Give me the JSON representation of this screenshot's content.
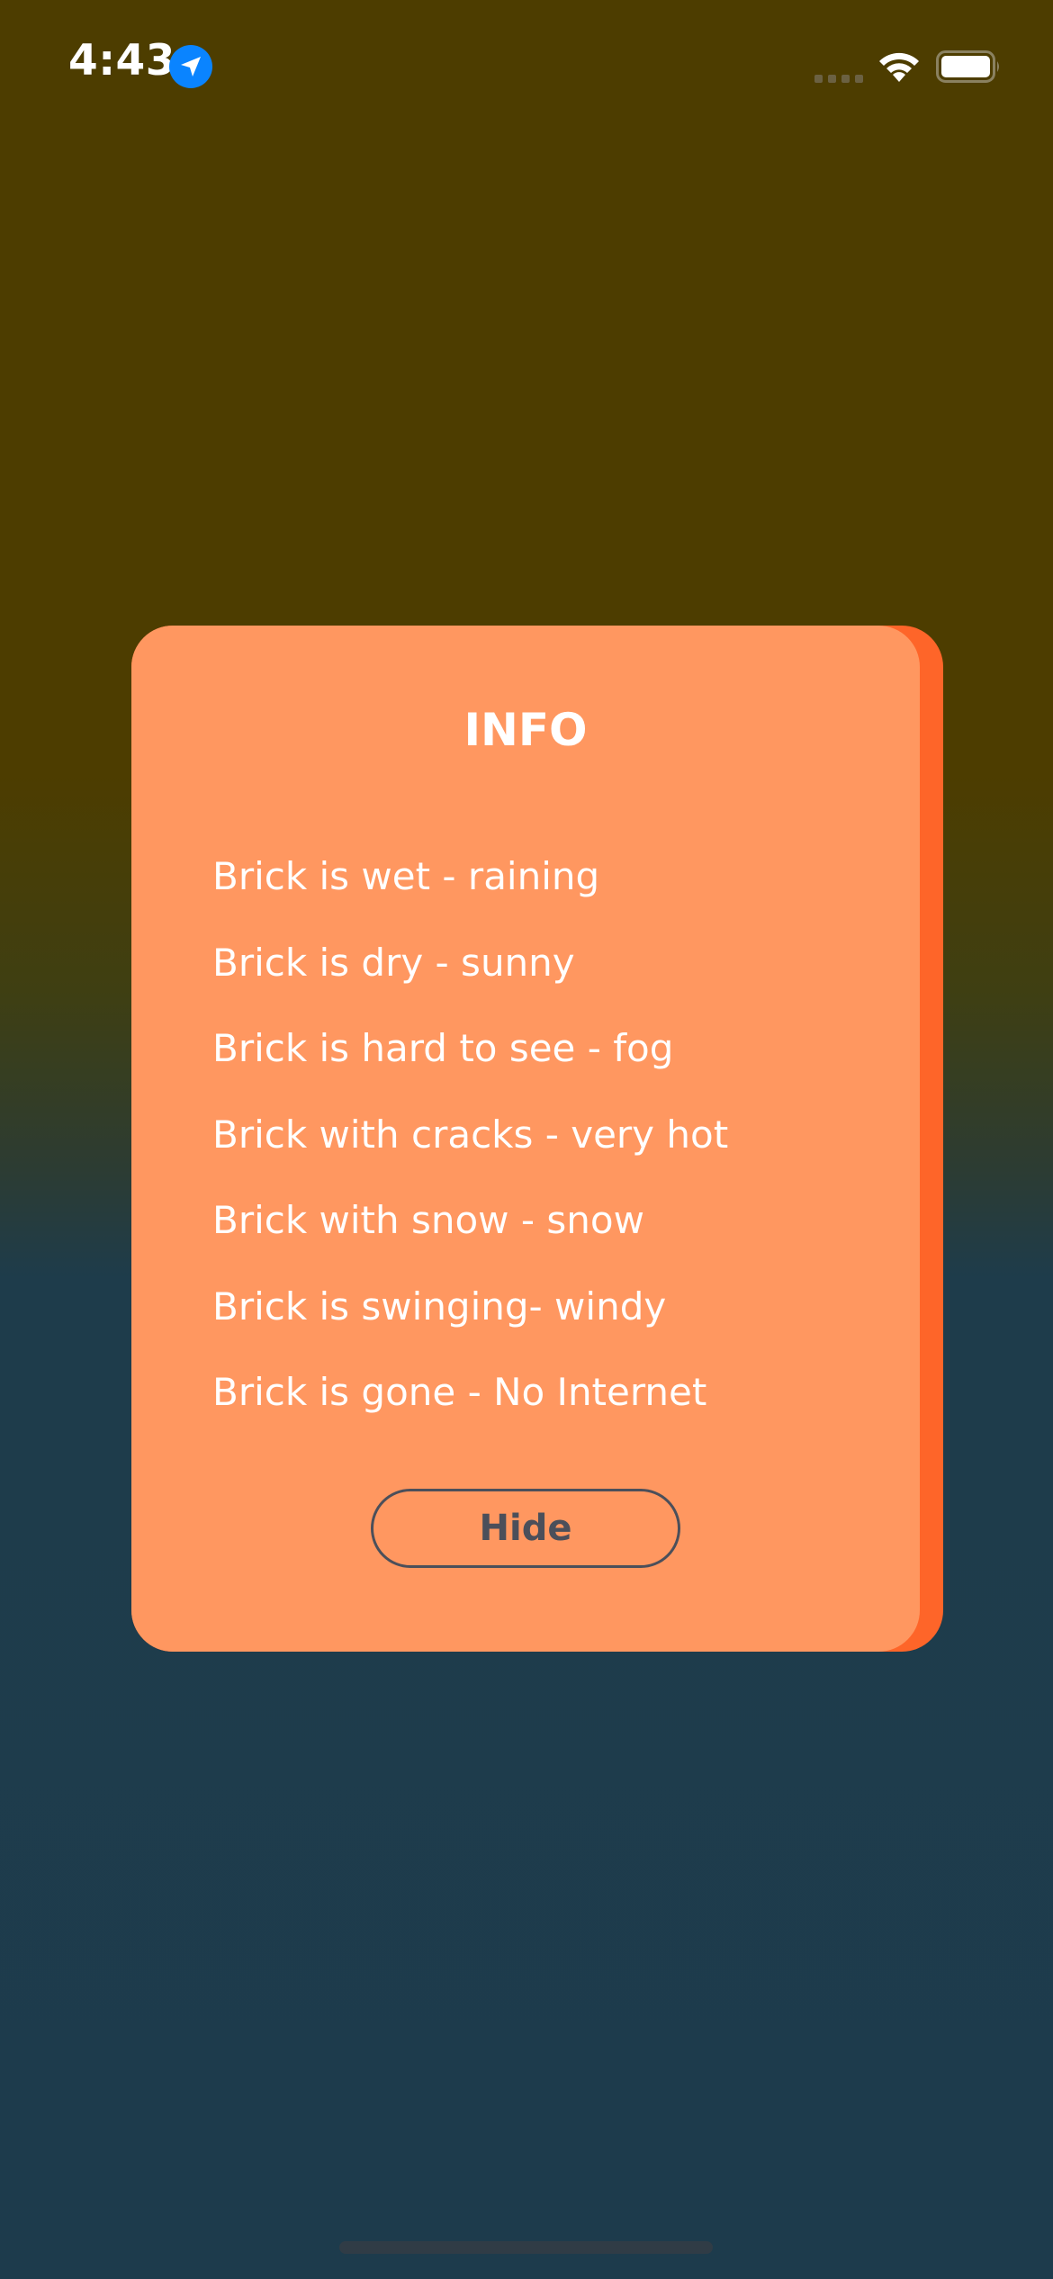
{
  "status_bar": {
    "time": "4:43",
    "location_icon": "location-arrow-icon",
    "signal_icon": "cellular-signal-icon",
    "wifi_icon": "wifi-icon",
    "battery_icon": "battery-icon",
    "battery_level": 1.0
  },
  "dialog": {
    "title": "INFO",
    "items": [
      "Brick is wet - raining",
      "Brick is dry - sunny",
      "Brick is hard to see - fog",
      "Brick with cracks - very hot",
      "Brick with snow - snow",
      "Brick is swinging- windy",
      "Brick is gone - No Internet"
    ],
    "hide_button_label": "Hide"
  },
  "colors": {
    "background_top": "#4d3d00",
    "background_bottom": "#1d3b4c",
    "card": "#ff9760",
    "card_accent": "#fe6529",
    "button_text": "#4b4f5a",
    "location_badge": "#0a84ff"
  }
}
